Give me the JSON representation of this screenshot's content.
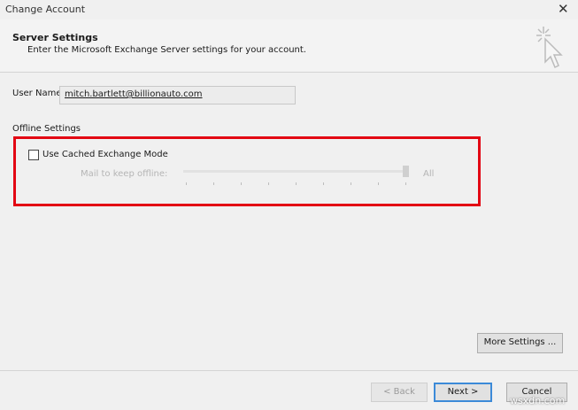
{
  "window": {
    "title": "Change Account",
    "close_icon": "close-icon"
  },
  "header": {
    "title": "Server Settings",
    "subtitle": "Enter the Microsoft Exchange Server settings for your account."
  },
  "user_name": {
    "label": "User Name:",
    "value": "mitch.bartlett@billionauto.com"
  },
  "offline": {
    "section_label": "Offline Settings",
    "checkbox_label": "Use Cached Exchange Mode",
    "checked": false,
    "slider_label": "Mail to keep offline:",
    "slider_value": "All",
    "slider_position_fraction": 1.0,
    "highlight_color": "#e30613"
  },
  "buttons": {
    "more_settings": "More Settings ...",
    "back": "< Back",
    "next": "Next >",
    "cancel": "Cancel"
  },
  "watermark": "wsxdn.com"
}
